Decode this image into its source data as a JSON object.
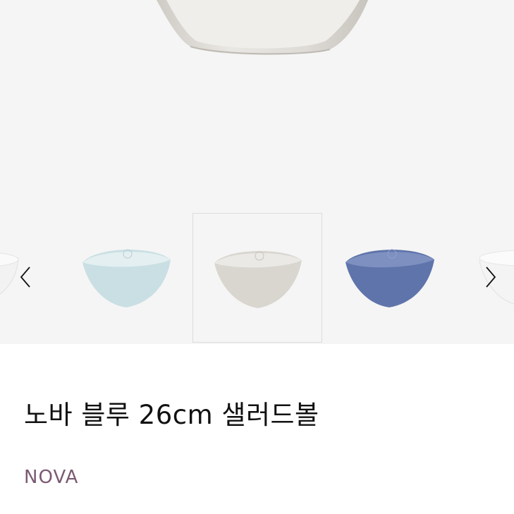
{
  "product": {
    "title": "노바 블루 26cm 샐러드볼",
    "brand": "NOVA"
  },
  "gallery": {
    "thumbnails": [
      {
        "name": "white-bowl",
        "color": "#f2f2f2"
      },
      {
        "name": "aqua-bowl",
        "color": "#c9dfe3"
      },
      {
        "name": "grey-bowl",
        "color": "#d9d6d0"
      },
      {
        "name": "blue-bowl",
        "color": "#5f74ab"
      },
      {
        "name": "white-bowl",
        "color": "#f4f4f4"
      }
    ],
    "selected_index": 2,
    "prev_icon": "chevron-left-icon",
    "next_icon": "chevron-right-icon"
  },
  "colors": {
    "background": "#f5f5f5",
    "brand": "#7b5a73"
  }
}
